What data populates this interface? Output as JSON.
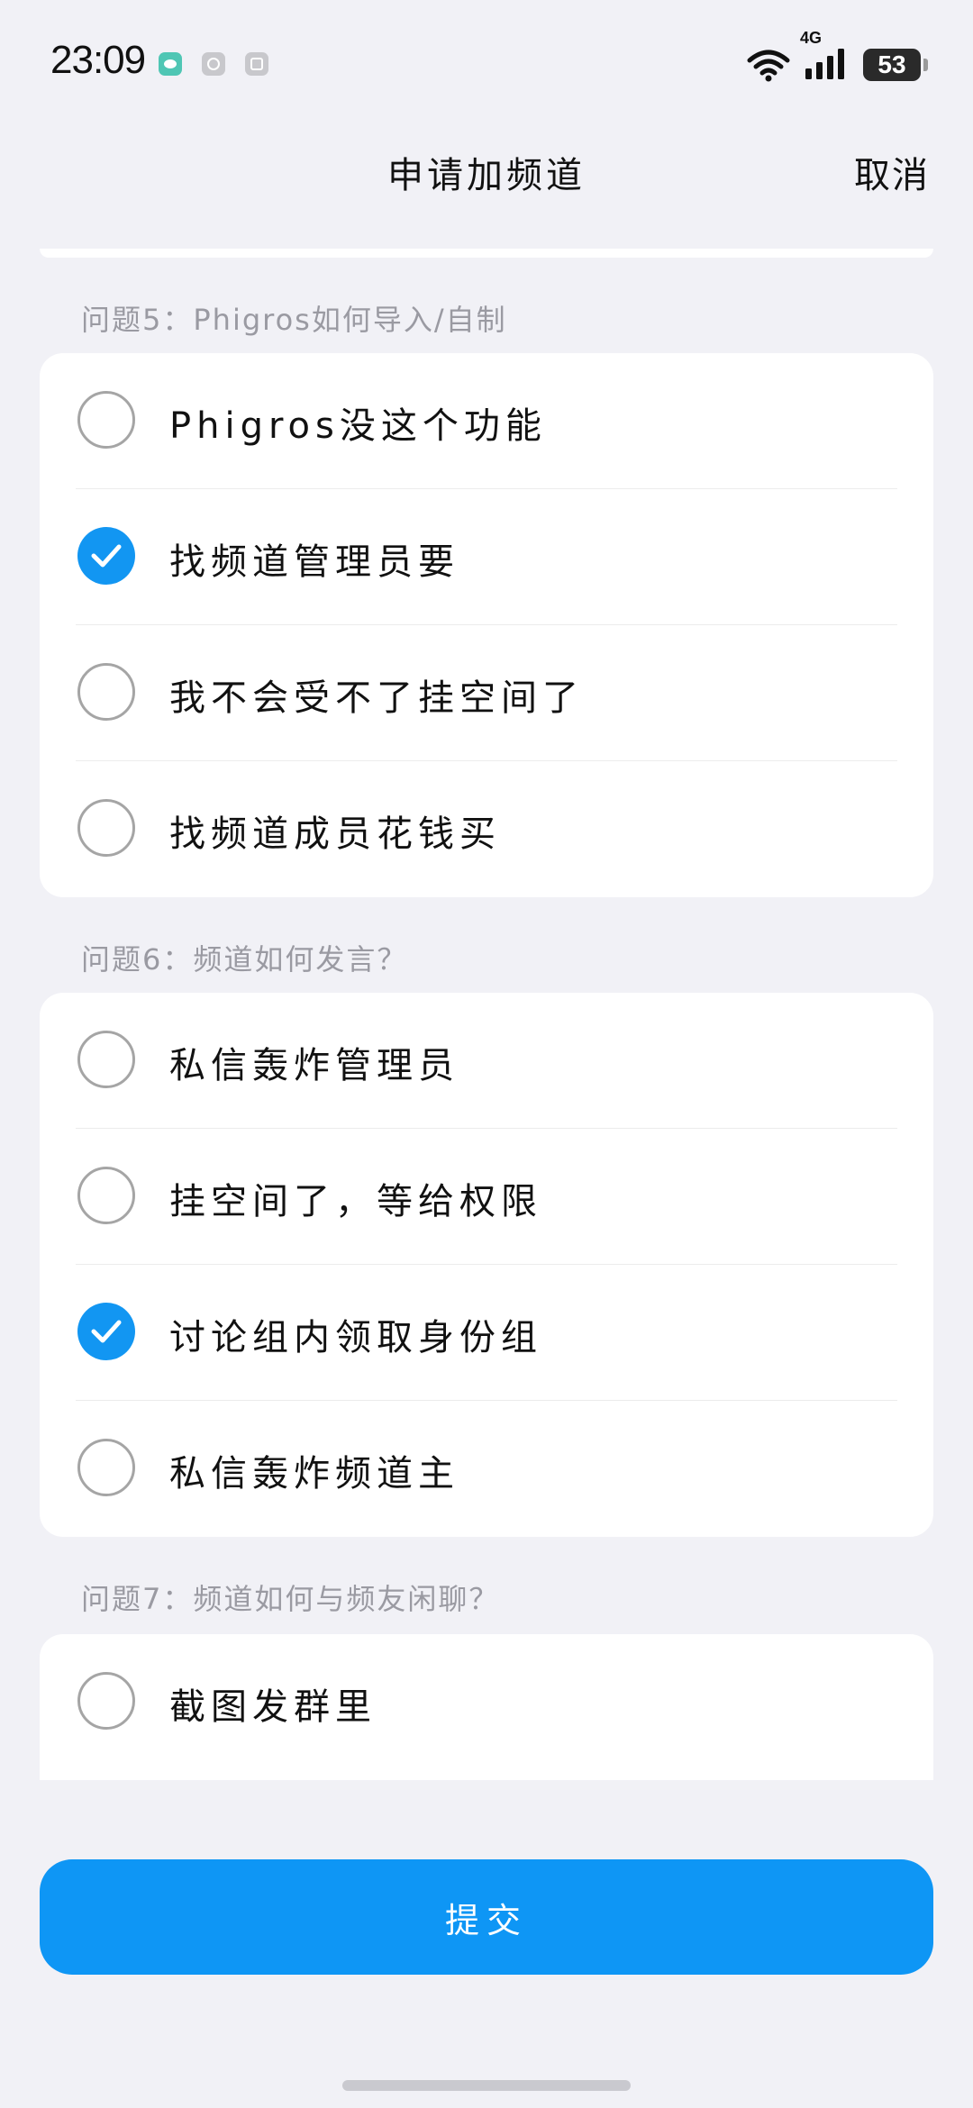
{
  "status_bar": {
    "time": "23:09",
    "network": "4G",
    "battery": "53",
    "app_icons": [
      "chat-app-icon",
      "sync-app-icon",
      "gallery-app-icon"
    ]
  },
  "header": {
    "title": "申请加频道",
    "cancel_label": "取消"
  },
  "questions": [
    {
      "label": "问题5：Phigros如何导入/自制",
      "options": [
        {
          "text": "Phigros没这个功能",
          "checked": false
        },
        {
          "text": "找频道管理员要",
          "checked": true
        },
        {
          "text": "我不会受不了挂空间了",
          "checked": false
        },
        {
          "text": "找频道成员花钱买",
          "checked": false
        }
      ]
    },
    {
      "label": "问题6：频道如何发言？",
      "options": [
        {
          "text": "私信轰炸管理员",
          "checked": false
        },
        {
          "text": "挂空间了，等给权限",
          "checked": false
        },
        {
          "text": "讨论组内领取身份组",
          "checked": true
        },
        {
          "text": "私信轰炸频道主",
          "checked": false
        }
      ]
    },
    {
      "label": "问题7：频道如何与频友闲聊？",
      "options": [
        {
          "text": "截图发群里",
          "checked": false
        }
      ]
    }
  ],
  "submit_label": "提交",
  "colors": {
    "accent": "#0e96f5",
    "background": "#f1f1f6",
    "muted_text": "#9a9aa2"
  }
}
